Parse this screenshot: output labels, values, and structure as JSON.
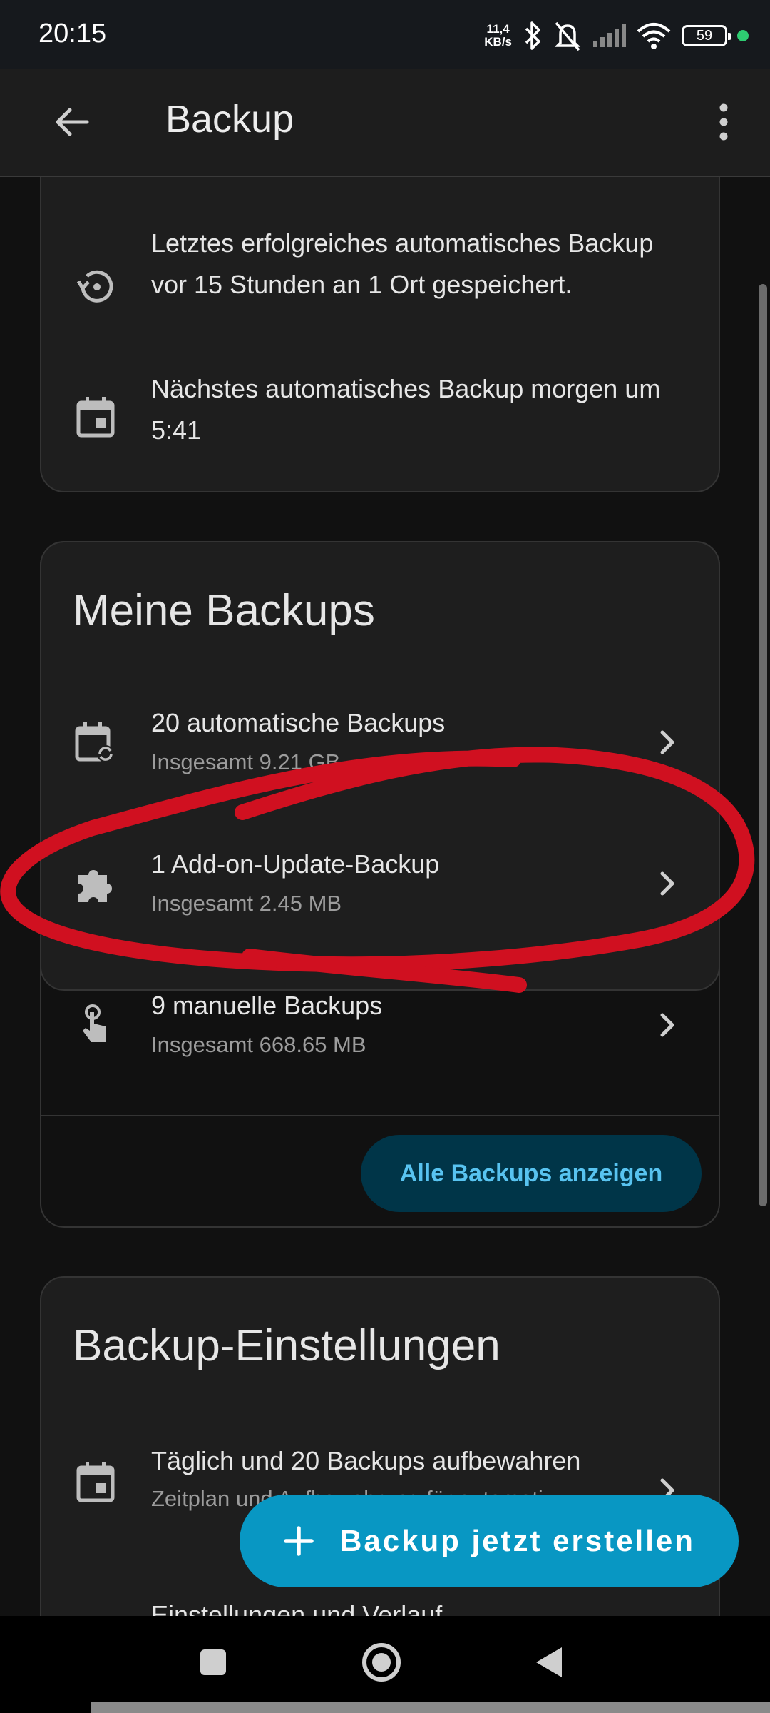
{
  "status": {
    "time": "20:15",
    "net_speed_top": "11,4",
    "net_speed_bottom": "KB/s",
    "battery": "59"
  },
  "appbar": {
    "title": "Backup",
    "icons": [
      "back-arrow-icon",
      "more-vert-icon"
    ]
  },
  "status_card": {
    "last_backup": "Letztes erfolgreiches automatisches Backup vor 15 Stunden an 1 Ort gespeichert.",
    "next_backup": "Nächstes automatisches Backup morgen um 5:41"
  },
  "my_backups": {
    "title": "Meine Backups",
    "items": [
      {
        "label": "20 automatische Backups",
        "sub": "Insgesamt 9.21 GB",
        "icon": "calendar-sync-icon"
      },
      {
        "label": "1 Add-on-Update-Backup",
        "sub": "Insgesamt 2.45 MB",
        "icon": "puzzle-icon"
      },
      {
        "label": "9 manuelle Backups",
        "sub": "Insgesamt 668.65 MB",
        "icon": "touch-icon"
      }
    ],
    "show_all": "Alle Backups anzeigen"
  },
  "settings": {
    "title": "Backup-Einstellungen",
    "schedule_title": "Täglich und 20 Backups aufbewahren",
    "schedule_sub": "Zeitplan und Aufbewahrung für automati",
    "next_item": "Einstellungen und Verlauf"
  },
  "fab": {
    "label": "Backup jetzt erstellen"
  },
  "colors": {
    "accent": "#0897c3",
    "annotation": "#d01020"
  }
}
